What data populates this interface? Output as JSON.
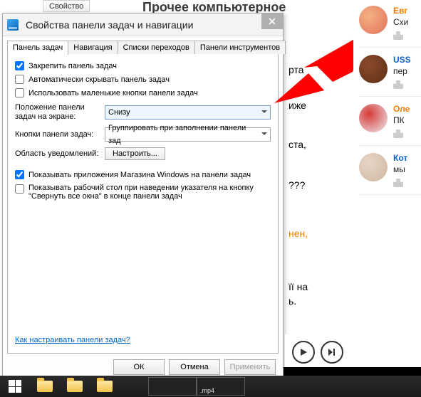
{
  "bg": {
    "tab_label": "Свойство",
    "heading": "Прочее компьютерное",
    "snippets": [
      "рта",
      "иже",
      "ста,",
      "???",
      "нен,",
      "її на",
      "ь."
    ],
    "snippet_orange": "нен,"
  },
  "dialog": {
    "title": "Свойства панели задач и навигации",
    "tabs": [
      "Панель задач",
      "Навигация",
      "Списки переходов",
      "Панели инструментов"
    ],
    "active_tab": 0,
    "checkbox_pin": "Закрепить панель задач",
    "checkbox_autohide": "Автоматически скрывать панель задач",
    "checkbox_smallbtn": "Использовать маленькие кнопки панели задач",
    "label_location": "Положение панели задач на экране:",
    "select_location": "Снизу",
    "label_buttons": "Кнопки панели задач:",
    "select_buttons": "Группировать при заполнении панели зад",
    "label_notify": "Область уведомлений:",
    "btn_customize": "Настроить...",
    "checkbox_store": "Показывать приложения Магазина Windows на панели задач",
    "checkbox_peek": "Показывать рабочий стол при наведении указателя на кнопку \"Свернуть все окна\" в конце панели задач",
    "help_link": "Как настраивать панели задач?",
    "btn_ok": "ОК",
    "btn_cancel": "Отмена",
    "btn_apply": "Применить",
    "checkbox_state": {
      "pin": true,
      "autohide": false,
      "smallbtn": false,
      "store": true,
      "peek": false
    }
  },
  "comments": [
    {
      "name": "Евг",
      "text": "Схи",
      "color1": "#f4b183",
      "color2": "#e2725b",
      "name_color": "#ee7f00"
    },
    {
      "name": "USS",
      "text": "пер",
      "color1": "#8b4a2b",
      "color2": "#5c2e14",
      "name_color": "#0b62c4"
    },
    {
      "name": "Оле",
      "text": "ПК",
      "color1": "#d63a3a",
      "color2": "#eeeeee",
      "name_color": "#ee7f00"
    },
    {
      "name": "Кот",
      "text": "мы",
      "color1": "#e8d5c8",
      "color2": "#cdb79e",
      "name_color": "#0b62c4"
    }
  ],
  "taskbar": {
    "preview_label": ".mp4"
  }
}
